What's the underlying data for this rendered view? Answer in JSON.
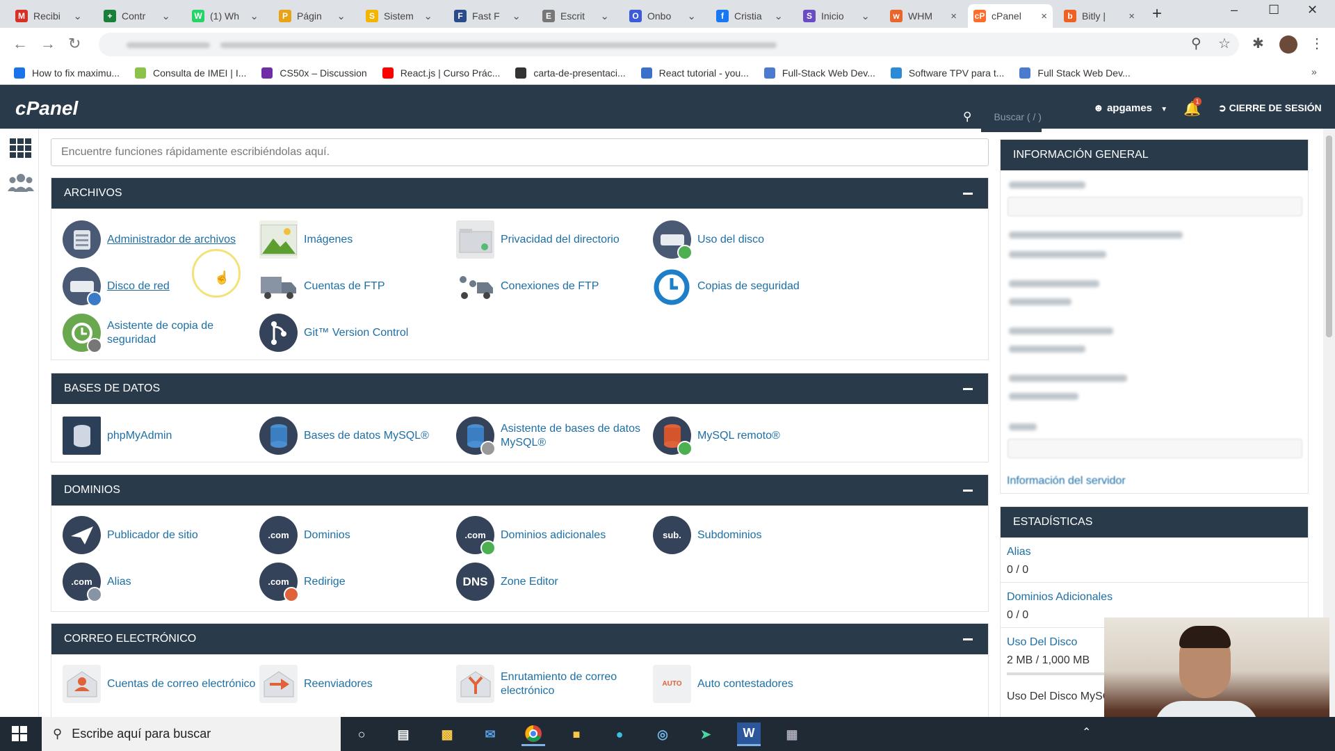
{
  "browser": {
    "tabs": [
      {
        "title": "Recibi",
        "icon": "gmail-icon",
        "color": "#d93025",
        "glyph": "M"
      },
      {
        "title": "Contr",
        "icon": "sheets-icon",
        "color": "#188038",
        "glyph": "+"
      },
      {
        "title": "(1) Wh",
        "icon": "whatsapp-icon",
        "color": "#25d366",
        "glyph": "W"
      },
      {
        "title": "Págin",
        "icon": "page-icon",
        "color": "#e8a317",
        "glyph": "P"
      },
      {
        "title": "Sistem",
        "icon": "system-icon",
        "color": "#f4b400",
        "glyph": "S"
      },
      {
        "title": "Fast F",
        "icon": "fastf-icon",
        "color": "#2b4c8c",
        "glyph": "F"
      },
      {
        "title": "Escrit",
        "icon": "desk-icon",
        "color": "#777",
        "glyph": "E"
      },
      {
        "title": "Onbo",
        "icon": "onboard-icon",
        "color": "#3b5bdb",
        "glyph": "O"
      },
      {
        "title": "Cristia",
        "icon": "facebook-icon",
        "color": "#1877f2",
        "glyph": "f"
      },
      {
        "title": "Inicio",
        "icon": "start-icon",
        "color": "#6a4bc4",
        "glyph": "S"
      },
      {
        "title": "WHM",
        "icon": "whm-icon",
        "color": "#e8652c",
        "glyph": "w"
      },
      {
        "title": "cPanel",
        "icon": "cpanel-tab-icon",
        "color": "#ff6c2c",
        "glyph": "cP",
        "active": true
      },
      {
        "title": "Bitly |",
        "icon": "bitly-icon",
        "color": "#ee6123",
        "glyph": "b"
      }
    ],
    "bookmarks": [
      {
        "label": "How to fix maximu...",
        "icon": "bookmark-page-icon",
        "color": "#1a73e8"
      },
      {
        "label": "Consulta de IMEI | I...",
        "icon": "imei-icon",
        "color": "#8bc34a"
      },
      {
        "label": "CS50x – Discussion",
        "icon": "edx-icon",
        "color": "#6f2da8"
      },
      {
        "label": "React.js | Curso Prác...",
        "icon": "youtube-icon",
        "color": "#ff0000"
      },
      {
        "label": "carta-de-presentaci...",
        "icon": "github-icon",
        "color": "#333"
      },
      {
        "label": "React tutorial - you...",
        "icon": "mdb-icon",
        "color": "#3b71ca"
      },
      {
        "label": "Full-Stack Web Dev...",
        "icon": "link-icon",
        "color": "#4a7bd0"
      },
      {
        "label": "Software TPV para t...",
        "icon": "tpv-icon",
        "color": "#2a8bd8"
      },
      {
        "label": "Full Stack Web Dev...",
        "icon": "link-icon",
        "color": "#4a7bd0"
      }
    ]
  },
  "cpanel": {
    "logo": "cPanel",
    "search_placeholder": "Buscar ( / )",
    "user": "apgames",
    "notifications": "1",
    "logout": "CIERRE DE SESIÓN",
    "quick_search_placeholder": "Encuentre funciones rápidamente escribiéndolas aquí."
  },
  "sections": {
    "files": {
      "title": "ARCHIVOS",
      "items": [
        "Administrador de archivos",
        "Imágenes",
        "Privacidad del directorio",
        "Uso del disco",
        "Disco de red",
        "Cuentas de FTP",
        "Conexiones de FTP",
        "Copias de seguridad",
        "Asistente de copia de seguridad",
        "Git™ Version Control"
      ]
    },
    "databases": {
      "title": "BASES DE DATOS",
      "items": [
        "phpMyAdmin",
        "Bases de datos MySQL®",
        "Asistente de bases de datos MySQL®",
        "MySQL remoto®"
      ]
    },
    "domains": {
      "title": "DOMINIOS",
      "items": [
        "Publicador de sitio",
        "Dominios",
        "Dominios adicionales",
        "Subdominios",
        "Alias",
        "Redirige",
        "Zone Editor"
      ]
    },
    "email": {
      "title": "CORREO ELECTRÓNICO",
      "items": [
        "Cuentas de correo electrónico",
        "Reenviadores",
        "Enrutamiento de correo electrónico",
        "Auto contestadores"
      ]
    }
  },
  "icon_glyphs": {
    "com": ".com",
    "sub": "sub.",
    "dns": "DNS",
    "auto": "AUTO"
  },
  "general_info": {
    "title": "INFORMACIÓN GENERAL",
    "server_info_link": "Información del servidor"
  },
  "stats": {
    "title": "ESTADÍSTICAS",
    "rows": [
      {
        "label": "Alias",
        "value": "0 / 0"
      },
      {
        "label": "Dominios Adicionales",
        "value": "0 / 0"
      },
      {
        "label": "Uso Del Disco",
        "value": "2 MB / 1,000 MB"
      },
      {
        "label": "Uso Del Disco MySQL",
        "value": ""
      }
    ]
  },
  "taskbar": {
    "search_placeholder": "Escribe aquí para buscar"
  }
}
